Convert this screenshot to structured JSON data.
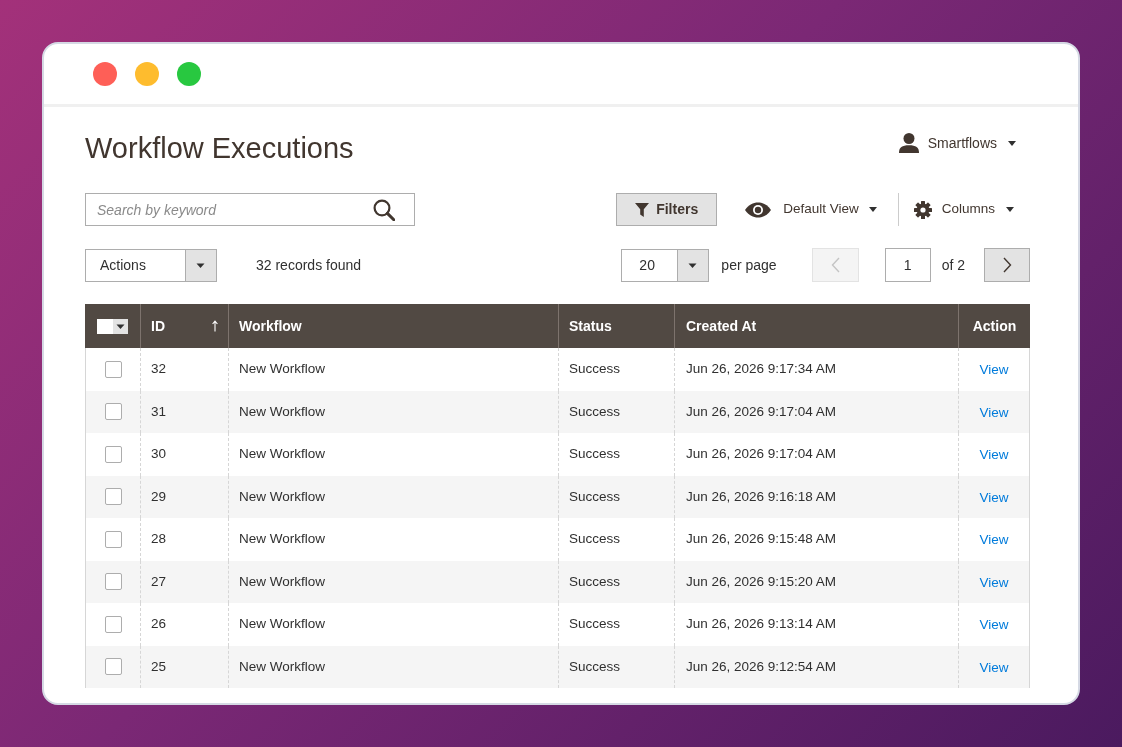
{
  "page": {
    "title": "Workflow Executions"
  },
  "user_menu": {
    "label": "Smartflows"
  },
  "search": {
    "placeholder": "Search by keyword"
  },
  "toolbar": {
    "filters_button": "Filters",
    "view_dropdown": "Default View",
    "columns_dropdown": "Columns"
  },
  "mass_actions": {
    "value": "Actions"
  },
  "records_found": "32 records found",
  "pagination": {
    "per_page": {
      "value": "20",
      "label": "per page"
    },
    "previous": {
      "disabled": true
    },
    "page": {
      "value": "1",
      "total": "of 2"
    },
    "next": {
      "disabled": false
    }
  },
  "table": {
    "select_all": {
      "checked": false
    },
    "columns": [
      {
        "label": "ID",
        "sorted": true
      },
      {
        "label": "Workflow",
        "sorted": false
      },
      {
        "label": "Status",
        "sorted": false
      },
      {
        "label": "Created At",
        "sorted": false
      },
      {
        "label": "Action",
        "sorted": false
      }
    ],
    "rows": [
      {
        "checked": false,
        "id": "32",
        "workflow": "New Workflow",
        "status": "Success",
        "created_at": "Jun 26, 2026 9:17:34 AM",
        "action": "View"
      },
      {
        "checked": false,
        "id": "31",
        "workflow": "New Workflow",
        "status": "Success",
        "created_at": "Jun 26, 2026 9:17:04 AM",
        "action": "View"
      },
      {
        "checked": false,
        "id": "30",
        "workflow": "New Workflow",
        "status": "Success",
        "created_at": "Jun 26, 2026 9:17:04 AM",
        "action": "View"
      },
      {
        "checked": false,
        "id": "29",
        "workflow": "New Workflow",
        "status": "Success",
        "created_at": "Jun 26, 2026 9:16:18 AM",
        "action": "View"
      },
      {
        "checked": false,
        "id": "28",
        "workflow": "New Workflow",
        "status": "Success",
        "created_at": "Jun 26, 2026 9:15:48 AM",
        "action": "View"
      },
      {
        "checked": false,
        "id": "27",
        "workflow": "New Workflow",
        "status": "Success",
        "created_at": "Jun 26, 2026 9:15:20 AM",
        "action": "View"
      },
      {
        "checked": false,
        "id": "26",
        "workflow": "New Workflow",
        "status": "Success",
        "created_at": "Jun 26, 2026 9:13:14 AM",
        "action": "View"
      },
      {
        "checked": false,
        "id": "25",
        "workflow": "New Workflow",
        "status": "Success",
        "created_at": "Jun 26, 2026 9:12:54 AM",
        "action": "View"
      }
    ]
  }
}
